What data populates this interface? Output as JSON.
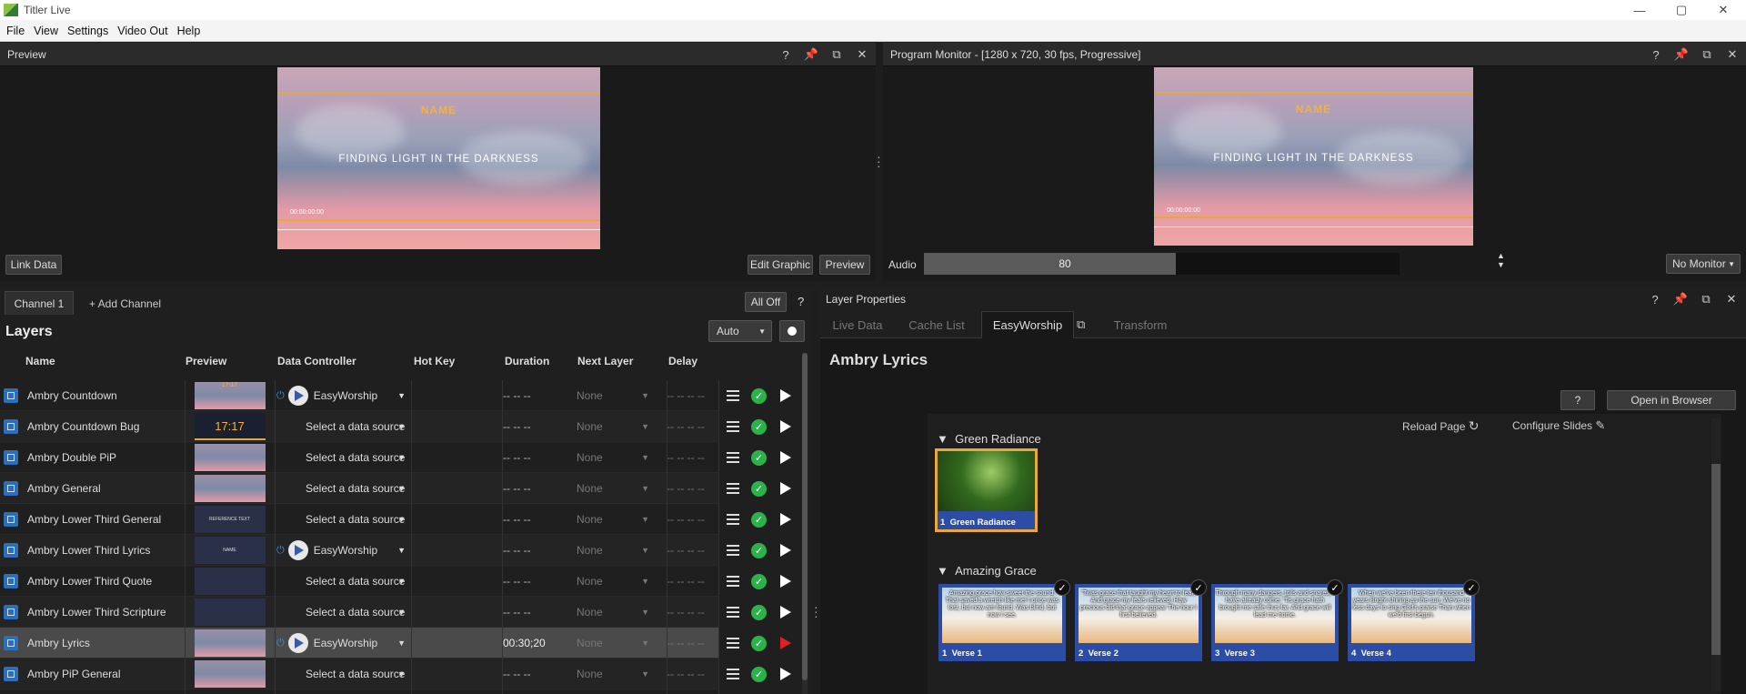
{
  "app": {
    "title": "Titler Live"
  },
  "window_controls": {
    "minimize": "—",
    "maximize": "▢",
    "close": "✕"
  },
  "menu": [
    "File",
    "View",
    "Settings",
    "Video Out",
    "Help"
  ],
  "preview_panel": {
    "title": "Preview",
    "graphic": {
      "name": "NAME",
      "text": "FINDING LIGHT IN THE DARKNESS",
      "timecode": "00:00:00:00"
    },
    "link_data": "Link Data",
    "edit_graphic": "Edit Graphic",
    "preview_btn": "Preview"
  },
  "program_monitor": {
    "title": "Program Monitor - [1280 x 720, 30 fps, Progressive]",
    "graphic": {
      "name": "NAME",
      "text": "FINDING LIGHT IN THE DARKNESS",
      "timecode": "00:00:00:00"
    },
    "audio_label": "Audio",
    "audio_value": "80",
    "audio_level": 0.53,
    "monitor_select": "No Monitor"
  },
  "channels": {
    "tab": "Channel 1",
    "add": "+ Add Channel",
    "all_off": "All Off",
    "help": "?"
  },
  "layers": {
    "heading": "Layers",
    "mode": "Auto",
    "columns": [
      "Name",
      "Preview",
      "Data Controller",
      "Hot Key",
      "Duration",
      "Next Layer",
      "Delay"
    ],
    "rows": [
      {
        "name": "Ambry Countdown",
        "preview": "17:17",
        "controller": "EasyWorship",
        "duration": "-- -- --",
        "next": "None",
        "delay": "-- -- -- --"
      },
      {
        "name": "Ambry Countdown Bug",
        "preview": "17:17",
        "controller": "Select a data source",
        "duration": "-- -- --",
        "next": "None",
        "delay": "-- -- -- --"
      },
      {
        "name": "Ambry Double PiP",
        "preview": "",
        "controller": "Select a data source",
        "duration": "-- -- --",
        "next": "None",
        "delay": "-- -- -- --"
      },
      {
        "name": "Ambry General",
        "preview": "",
        "controller": "Select a data source",
        "duration": "-- -- --",
        "next": "None",
        "delay": "-- -- -- --"
      },
      {
        "name": "Ambry Lower Third General",
        "preview": "REFERENCE TEXT",
        "controller": "Select a data source",
        "duration": "-- -- --",
        "next": "None",
        "delay": "-- -- -- --"
      },
      {
        "name": "Ambry Lower Third Lyrics",
        "preview": "NAME",
        "controller": "EasyWorship",
        "duration": "-- -- --",
        "next": "None",
        "delay": "-- -- -- --"
      },
      {
        "name": "Ambry Lower Third Quote",
        "preview": "",
        "controller": "Select a data source",
        "duration": "-- -- --",
        "next": "None",
        "delay": "-- -- -- --"
      },
      {
        "name": "Ambry Lower Third Scripture",
        "preview": "",
        "controller": "Select a data source",
        "duration": "-- -- --",
        "next": "None",
        "delay": "-- -- -- --"
      },
      {
        "name": "Ambry Lyrics",
        "preview": "",
        "controller": "EasyWorship",
        "duration": "00:30;20",
        "next": "None",
        "delay": "-- -- -- --"
      },
      {
        "name": "Ambry PiP General",
        "preview": "",
        "controller": "Select a data source",
        "duration": "-- -- --",
        "next": "None",
        "delay": "-- -- -- --"
      }
    ]
  },
  "layer_properties": {
    "title": "Layer Properties",
    "tabs": [
      "Live Data",
      "Cache List",
      "EasyWorship",
      "Transform"
    ],
    "active_tab": "EasyWorship",
    "layer_name": "Ambry Lyrics",
    "help": "?",
    "open_browser": "Open in Browser",
    "reload": "Reload Page",
    "configure": "Configure Slides",
    "groups": [
      {
        "name": "Green Radiance",
        "slides": [
          {
            "num": "1",
            "label": "Green Radiance"
          }
        ]
      },
      {
        "name": "Amazing Grace",
        "slides": [
          {
            "num": "1",
            "label": "Verse 1",
            "lyrics": "Amazing grace how sweet the sound, That saved a wretch like me! I once was lost, but now am found, Was blind, but now I see."
          },
          {
            "num": "2",
            "label": "Verse 2",
            "lyrics": "'Twas grace that taught my heart to fear, And grace my fears relieved; How precious did that grace appear The hour I first believed."
          },
          {
            "num": "3",
            "label": "Verse 3",
            "lyrics": "Through many dangers, toils and snares, I have already come; 'Tis grace hath brought me safe thus far, And grace will lead me home."
          },
          {
            "num": "4",
            "label": "Verse 4",
            "lyrics": "When we've been there ten thousand years Bright shining as the sun, We've no less days to sing God's praise Than when we'd first begun."
          }
        ]
      }
    ]
  }
}
